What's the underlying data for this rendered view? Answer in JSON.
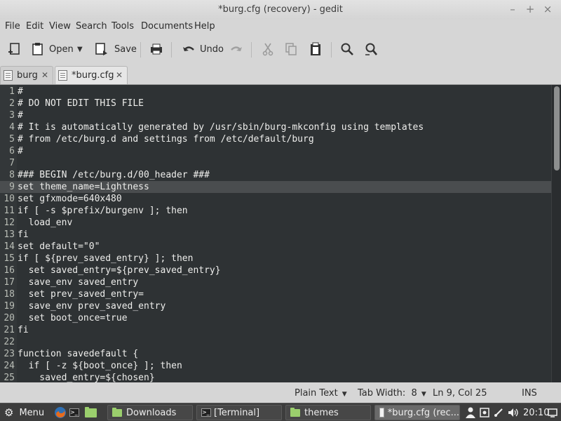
{
  "window": {
    "title": "*burg.cfg (recovery) - gedit"
  },
  "menu": [
    "File",
    "Edit",
    "View",
    "Search",
    "Tools",
    "Documents",
    "Help"
  ],
  "toolbar": {
    "open_label": "Open",
    "save_label": "Save",
    "undo_label": "Undo"
  },
  "tabs": [
    {
      "label": "burg",
      "active": false
    },
    {
      "label": "*burg.cfg",
      "active": true
    }
  ],
  "editor": {
    "current_line": 9,
    "lines": [
      {
        "n": "1",
        "text": "#"
      },
      {
        "n": "2",
        "text": "# DO NOT EDIT THIS FILE"
      },
      {
        "n": "3",
        "text": "#"
      },
      {
        "n": "4",
        "text": "# It is automatically generated by /usr/sbin/burg-mkconfig using templates"
      },
      {
        "n": "5",
        "text": "# from /etc/burg.d and settings from /etc/default/burg"
      },
      {
        "n": "6",
        "text": "#"
      },
      {
        "n": "7",
        "text": ""
      },
      {
        "n": "8",
        "text": "### BEGIN /etc/burg.d/00_header ###"
      },
      {
        "n": "9",
        "text": "set theme_name=Lightness"
      },
      {
        "n": "10",
        "text": "set gfxmode=640x480"
      },
      {
        "n": "11",
        "text": "if [ -s $prefix/burgenv ]; then"
      },
      {
        "n": "12",
        "text": "  load_env"
      },
      {
        "n": "13",
        "text": "fi"
      },
      {
        "n": "14",
        "text": "set default=\"0\""
      },
      {
        "n": "15",
        "text": "if [ ${prev_saved_entry} ]; then"
      },
      {
        "n": "16",
        "text": "  set saved_entry=${prev_saved_entry}"
      },
      {
        "n": "17",
        "text": "  save_env saved_entry"
      },
      {
        "n": "18",
        "text": "  set prev_saved_entry="
      },
      {
        "n": "19",
        "text": "  save_env prev_saved_entry"
      },
      {
        "n": "20",
        "text": "  set boot_once=true"
      },
      {
        "n": "21",
        "text": "fi"
      },
      {
        "n": "22",
        "text": ""
      },
      {
        "n": "23",
        "text": "function savedefault {"
      },
      {
        "n": "24",
        "text": "  if [ -z ${boot_once} ]; then"
      },
      {
        "n": "25",
        "text": "    saved_entry=${chosen}"
      }
    ]
  },
  "status": {
    "language": "Plain Text",
    "tab_width": "Tab Width:  8",
    "position": "Ln 9, Col 25",
    "mode": "INS"
  },
  "taskbar": {
    "menu_label": "Menu",
    "windows": [
      {
        "label": "Downloads",
        "icon": "folder-icon"
      },
      {
        "label": "[Terminal]",
        "icon": "terminal-icon"
      },
      {
        "label": "themes",
        "icon": "folder-icon"
      },
      {
        "label": "*burg.cfg (rec...",
        "icon": "text-editor-icon"
      }
    ],
    "clock": "20:10"
  },
  "colors": {
    "editor_bg": "#2e3234",
    "current_line_bg": "#4a4d4f",
    "line_number": "#b9bdb6",
    "code_text": "#eeeeec",
    "folder_green": "#9bcf6d"
  }
}
